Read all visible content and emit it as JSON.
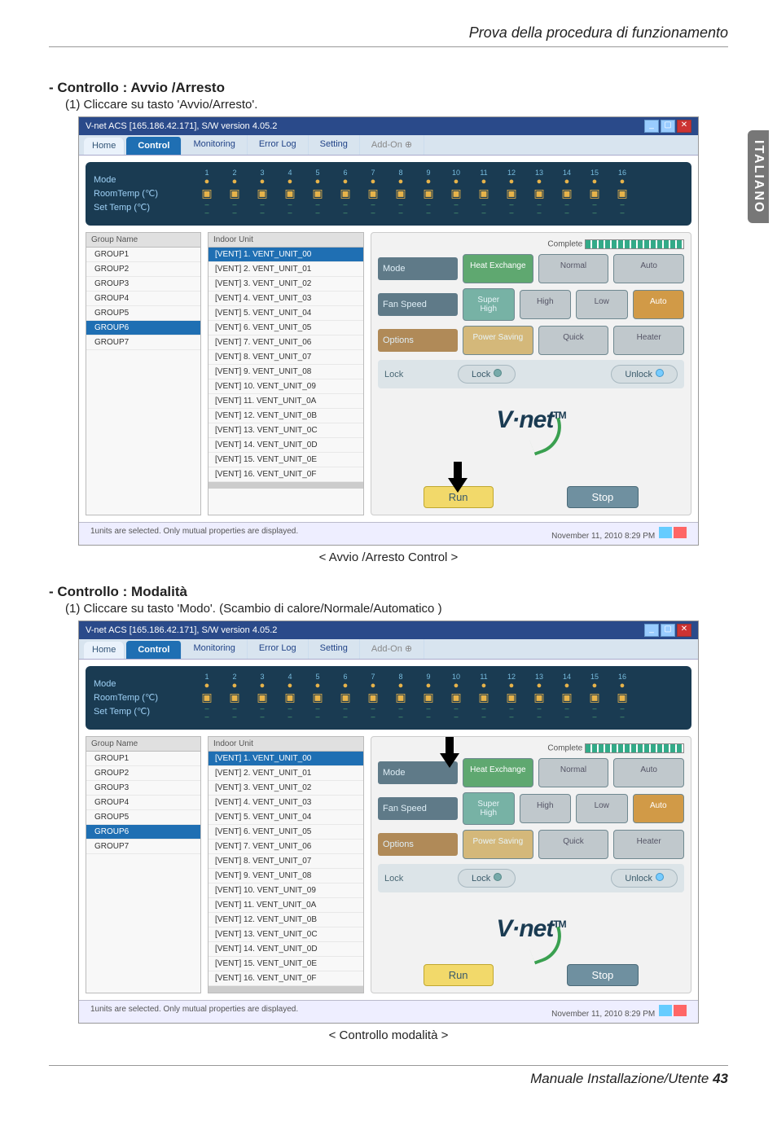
{
  "doc": {
    "breadcrumb": "Prova della procedura di funzionamento",
    "side_tab": "ITALIANO",
    "footer_text": "Manuale Installazione/Utente ",
    "footer_page": "43"
  },
  "section1": {
    "title": "- Controllo : Avvio /Arresto",
    "sub": "(1) Cliccare su tasto 'Avvio/Arresto'.",
    "caption": "< Avvio /Arresto Control >"
  },
  "section2": {
    "title": "- Controllo : Modalità",
    "sub": "(1) Cliccare su tasto 'Modo'. (Scambio di calore/Normale/Automatico )",
    "caption": "< Controllo modalità >"
  },
  "app": {
    "title": "V-net ACS [165.186.42.171],   S/W version 4.05.2",
    "tabs": {
      "home": "Home",
      "control": "Control",
      "monitoring": "Monitoring",
      "errorlog": "Error Log",
      "setting": "Setting",
      "addon": "Add-On"
    },
    "mode_box": {
      "mode": "Mode",
      "room": "RoomTemp (℃)",
      "set": "Set Temp  (℃)"
    },
    "unit_nums": [
      "1",
      "2",
      "3",
      "4",
      "5",
      "6",
      "7",
      "8",
      "9",
      "10",
      "11",
      "12",
      "13",
      "14",
      "15",
      "16"
    ],
    "groups_hdr": "Group Name",
    "groups": [
      "GROUP1",
      "GROUP2",
      "GROUP3",
      "GROUP4",
      "GROUP5",
      "GROUP6",
      "GROUP7"
    ],
    "group_selected_index": 5,
    "units_hdr": "Indoor Unit",
    "units": [
      "[VENT] 1. VENT_UNIT_00",
      "[VENT] 2. VENT_UNIT_01",
      "[VENT] 3. VENT_UNIT_02",
      "[VENT] 4. VENT_UNIT_03",
      "[VENT] 5. VENT_UNIT_04",
      "[VENT] 6. VENT_UNIT_05",
      "[VENT] 7. VENT_UNIT_06",
      "[VENT] 8. VENT_UNIT_07",
      "[VENT] 9. VENT_UNIT_08",
      "[VENT] 10. VENT_UNIT_09",
      "[VENT] 11. VENT_UNIT_0A",
      "[VENT] 12. VENT_UNIT_0B",
      "[VENT] 13. VENT_UNIT_0C",
      "[VENT] 14. VENT_UNIT_0D",
      "[VENT] 15. VENT_UNIT_0E",
      "[VENT] 16. VENT_UNIT_0F"
    ],
    "unit_selected_index": 0,
    "complete_label": "Complete",
    "ctrl": {
      "mode_label": "Mode",
      "mode_opts": [
        "Heat Exchange",
        "Normal",
        "Auto"
      ],
      "fan_label": "Fan Speed",
      "fan_opts": [
        "Super High",
        "High",
        "Low",
        "Auto"
      ],
      "opt_label": "Options",
      "opt_opts": [
        "Power Saving",
        "Quick",
        "Heater"
      ],
      "lock_label": "Lock",
      "lock_btn": "Lock",
      "unlock_btn": "Unlock"
    },
    "logo": "V·net",
    "logo_tm": "TM",
    "run": "Run",
    "stop": "Stop",
    "status_left": "1units are selected. Only mutual properties are displayed.",
    "status_right": "November 11, 2010  8:29 PM"
  }
}
